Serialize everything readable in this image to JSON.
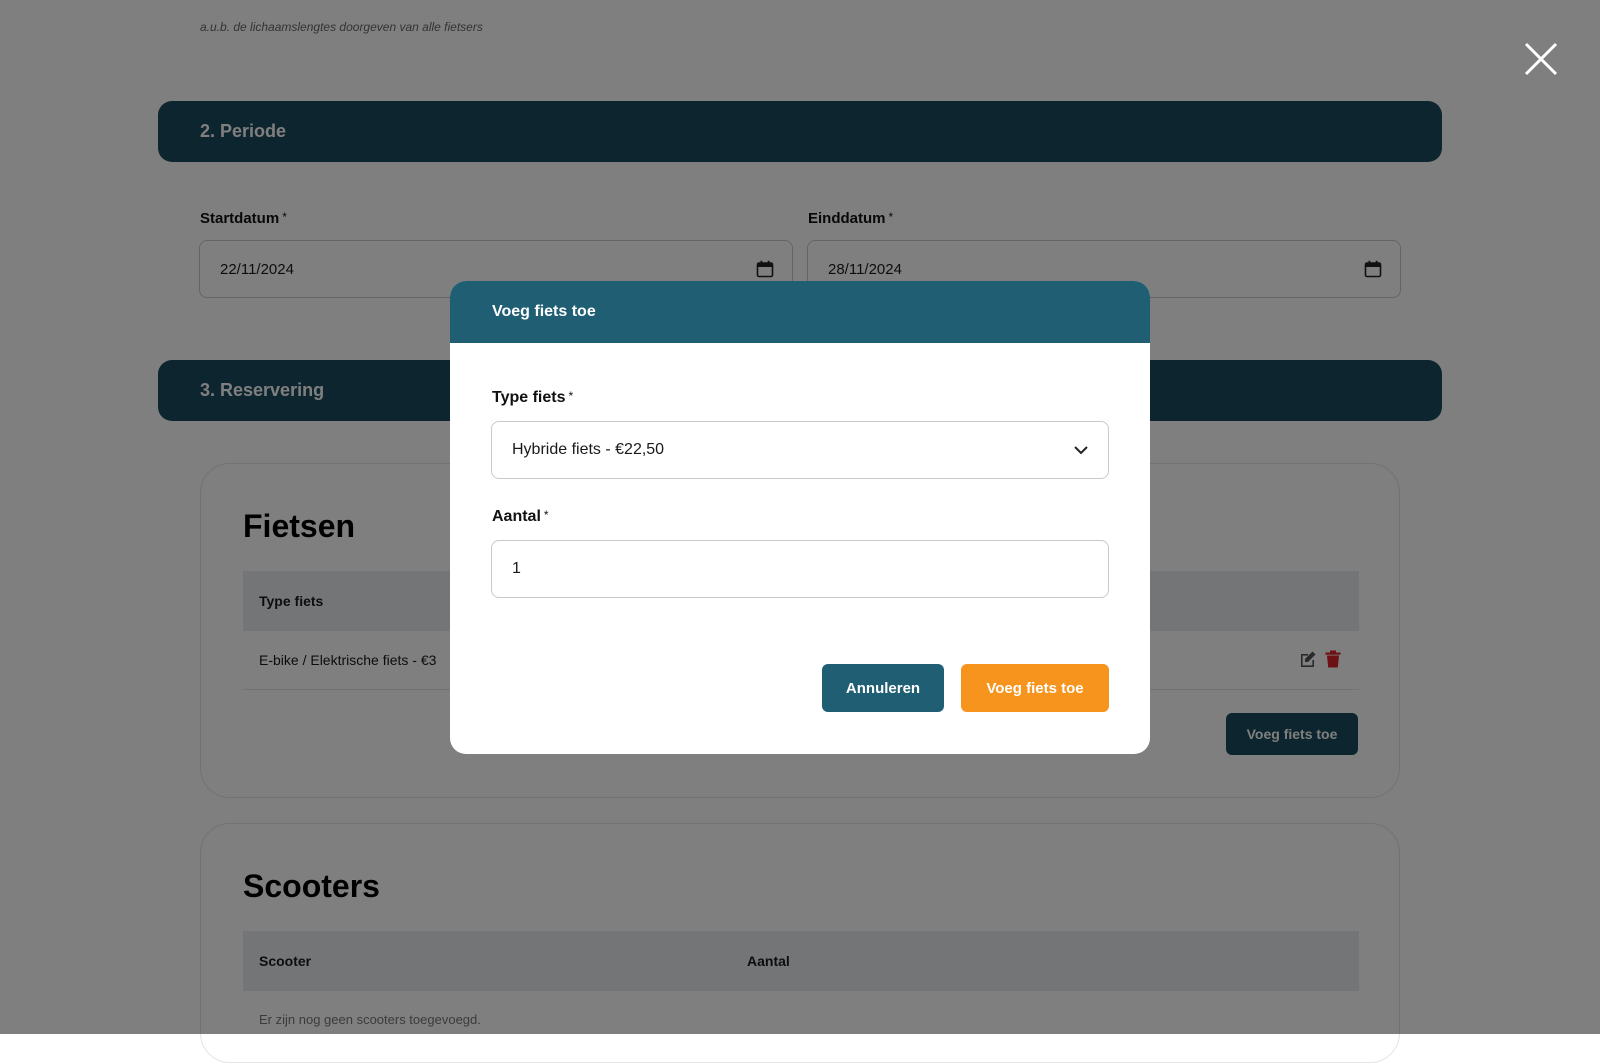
{
  "form": {
    "hint": "a.u.b. de lichaamslengtes doorgeven van alle fietsers",
    "periode_header": "2. Periode",
    "start_label": "Startdatum",
    "start_value": "22/11/2024",
    "end_label": "Einddatum",
    "end_value": "28/11/2024",
    "reservering_header": "3. Reservering",
    "required_mark": "*"
  },
  "bikes": {
    "title": "Fietsen",
    "col_type": "Type fiets",
    "row_text": "E-bike / Elektrische fiets - €3",
    "add_button": "Voeg fiets toe"
  },
  "scooters": {
    "title": "Scooters",
    "col_scooter": "Scooter",
    "col_aantal": "Aantal",
    "empty": "Er zijn nog geen scooters toegevoegd."
  },
  "modal": {
    "title": "Voeg fiets toe",
    "type_label": "Type fiets",
    "type_value": "Hybride fiets - €22,50",
    "aantal_label": "Aantal",
    "aantal_value": "1",
    "cancel": "Annuleren",
    "submit": "Voeg fiets toe"
  },
  "colors": {
    "header_dark": "#1a4a5e",
    "modal_header": "#1f5e73",
    "accent_orange": "#f7941d",
    "delete_red": "#d9232a"
  },
  "icons": {
    "close": "close-icon",
    "calendar": "calendar-icon",
    "chevron": "chevron-down-icon",
    "edit": "edit-icon",
    "delete": "trash-icon"
  }
}
